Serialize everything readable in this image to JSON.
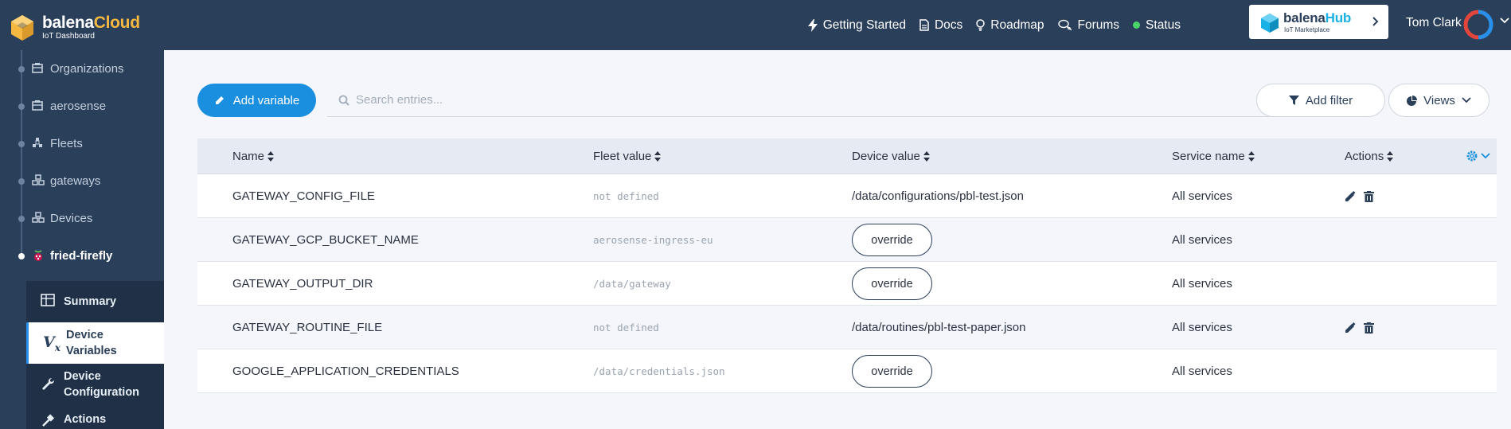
{
  "brand": {
    "name_part1": "balena",
    "name_part2": "Cloud",
    "subtitle": "IoT Dashboard"
  },
  "topnav": {
    "links": [
      {
        "label": "Getting Started",
        "icon": "bolt-icon"
      },
      {
        "label": "Docs",
        "icon": "doc-icon"
      },
      {
        "label": "Roadmap",
        "icon": "bulb-icon"
      },
      {
        "label": "Forums",
        "icon": "chat-icon"
      },
      {
        "label": "Status",
        "icon": "status-dot-icon"
      }
    ],
    "hub": {
      "title_part1": "balena",
      "title_part2": "Hub",
      "subtitle": "IoT Marketplace"
    },
    "user": "Tom Clark"
  },
  "sidebar": {
    "crumbs": [
      {
        "label": "Organizations",
        "icon": "org-icon"
      },
      {
        "label": "aerosense",
        "icon": "org-icon"
      },
      {
        "label": "Fleets",
        "icon": "fleets-icon"
      },
      {
        "label": "gateways",
        "icon": "fleet-icon"
      },
      {
        "label": "Devices",
        "icon": "devices-icon"
      },
      {
        "label": "fried-firefly",
        "icon": "raspberry-pi-icon"
      }
    ],
    "subnav": [
      {
        "line1": "Summary",
        "line2": ""
      },
      {
        "line1": "Device",
        "line2": "Variables"
      },
      {
        "line1": "Device",
        "line2": "Configuration"
      },
      {
        "line1": "Actions",
        "line2": ""
      }
    ]
  },
  "toolbar": {
    "add_label": "Add variable",
    "search_placeholder": "Search entries...",
    "clear": "×",
    "filter_label": "Add filter",
    "views_label": "Views"
  },
  "table": {
    "columns": [
      "Name",
      "Fleet value",
      "Device value",
      "Service name",
      "Actions"
    ],
    "rows": [
      {
        "name": "GATEWAY_CONFIG_FILE",
        "fleet": "not defined",
        "device": "/data/configurations/pbl-test.json",
        "service": "All services",
        "editable": true
      },
      {
        "name": "GATEWAY_GCP_BUCKET_NAME",
        "fleet": "aerosense-ingress-eu",
        "device": "override",
        "service": "All services",
        "editable": false
      },
      {
        "name": "GATEWAY_OUTPUT_DIR",
        "fleet": "/data/gateway",
        "device": "override",
        "service": "All services",
        "editable": false
      },
      {
        "name": "GATEWAY_ROUTINE_FILE",
        "fleet": "not defined",
        "device": "/data/routines/pbl-test-paper.json",
        "service": "All services",
        "editable": true
      },
      {
        "name": "GOOGLE_APPLICATION_CREDENTIALS",
        "fleet": "/data/credentials.json",
        "device": "override",
        "service": "All services",
        "editable": false
      }
    ]
  },
  "colors": {
    "nav": "#2a3f5a",
    "accent": "#1a8fe0",
    "brand_cloud": "#f5b942",
    "hub_blue": "#19b1e6"
  }
}
